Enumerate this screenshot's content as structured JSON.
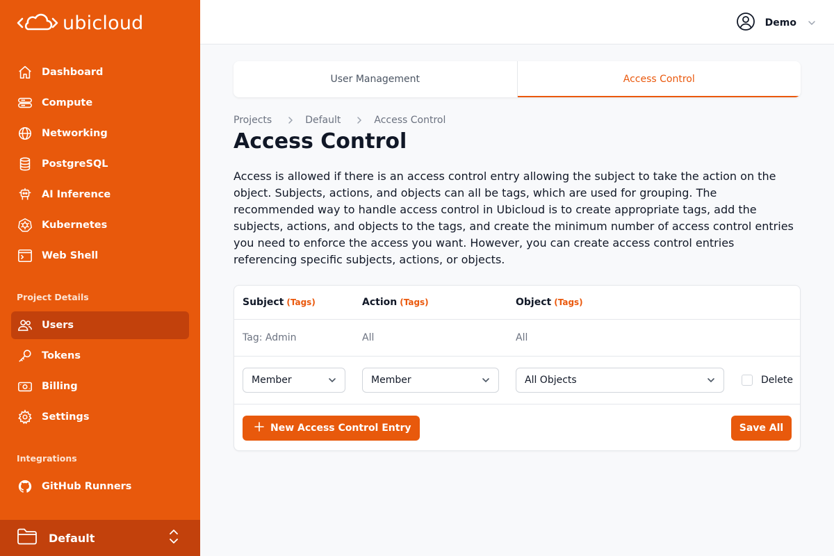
{
  "app": {
    "logo_text": "ubicloud"
  },
  "sidebar": {
    "main_items": [
      {
        "label": "Dashboard",
        "icon": "home-icon"
      },
      {
        "label": "Compute",
        "icon": "server-icon"
      },
      {
        "label": "Networking",
        "icon": "globe-icon"
      },
      {
        "label": "PostgreSQL",
        "icon": "database-icon"
      },
      {
        "label": "AI Inference",
        "icon": "robot-icon"
      },
      {
        "label": "Kubernetes",
        "icon": "kubernetes-icon"
      },
      {
        "label": "Web Shell",
        "icon": "terminal-icon"
      }
    ],
    "project_section_title": "Project Details",
    "project_items": [
      {
        "label": "Users",
        "icon": "users-icon",
        "active": true
      },
      {
        "label": "Tokens",
        "icon": "key-icon"
      },
      {
        "label": "Billing",
        "icon": "billing-icon"
      },
      {
        "label": "Settings",
        "icon": "gear-icon"
      }
    ],
    "integrations_title": "Integrations",
    "integration_items": [
      {
        "label": "GitHub Runners",
        "icon": "github-icon"
      }
    ],
    "project_switcher": {
      "label": "Default"
    }
  },
  "header": {
    "user_name": "Demo"
  },
  "tabs": [
    {
      "label": "User Management",
      "active": false
    },
    {
      "label": "Access Control",
      "active": true
    }
  ],
  "breadcrumb": [
    "Projects",
    "Default",
    "Access Control"
  ],
  "page": {
    "title": "Access Control",
    "description": "Access is allowed if there is an access control entry allowing the subject to take the action on the object. Subjects, actions, and objects can all be tags, which are used for grouping. The recommended way to handle access control in Ubicloud is to create appropriate tags, add the subjects, actions, and objects to the tags, and create the minimum number of access control entries you need to enforce the access you want. However, you can create access control entries referencing specific subjects, actions, or objects."
  },
  "table": {
    "columns": [
      {
        "label": "Subject",
        "tag": "(Tags)"
      },
      {
        "label": "Action",
        "tag": "(Tags)"
      },
      {
        "label": "Object",
        "tag": "(Tags)"
      }
    ],
    "static_row": [
      "Tag: Admin",
      "All",
      "All"
    ],
    "edit_row": {
      "subject": "Member",
      "action": "Member",
      "object": "All Objects",
      "delete_label": "Delete"
    },
    "new_entry_label": "New Access Control Entry",
    "save_label": "Save All"
  },
  "colors": {
    "brand": "#e8590c",
    "brand_dark": "#c2410c",
    "accent_text": "#ea580c"
  }
}
